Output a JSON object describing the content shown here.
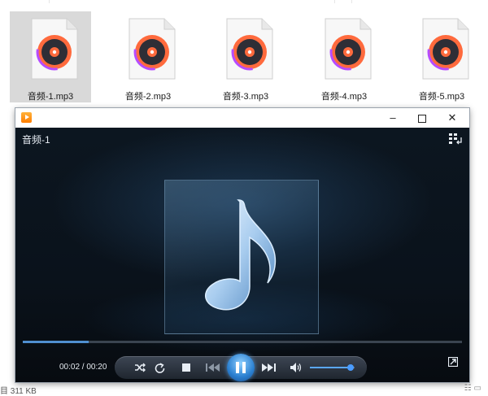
{
  "explorer": {
    "files": [
      {
        "name": "音频-1.mp3",
        "selected": true
      },
      {
        "name": "音频-2.mp3",
        "selected": false
      },
      {
        "name": "音频-3.mp3",
        "selected": false
      },
      {
        "name": "音频-4.mp3",
        "selected": false
      },
      {
        "name": "音频-5.mp3",
        "selected": false
      }
    ],
    "status_left": "目  311 KB",
    "status_right": "☷ ▭"
  },
  "player": {
    "window_icon": "media-player-icon",
    "window_controls": {
      "minimize": "–",
      "close": "✕"
    },
    "media_title": "音频-1",
    "artwork_icon": "music-note-icon",
    "time": {
      "current": "00:02",
      "total": "00:20",
      "display": "00:02 / 00:20"
    },
    "progress": 0.15,
    "volume": 0.9,
    "controls": {
      "shuffle": "shuffle-icon",
      "repeat": "repeat-icon",
      "stop": "stop-icon",
      "previous": "previous-icon",
      "play_pause": "pause-icon",
      "next": "next-icon",
      "volume": "volume-icon"
    },
    "colors": {
      "accent": "#4a9cff",
      "seek_fill": "#4f8fd0"
    }
  }
}
